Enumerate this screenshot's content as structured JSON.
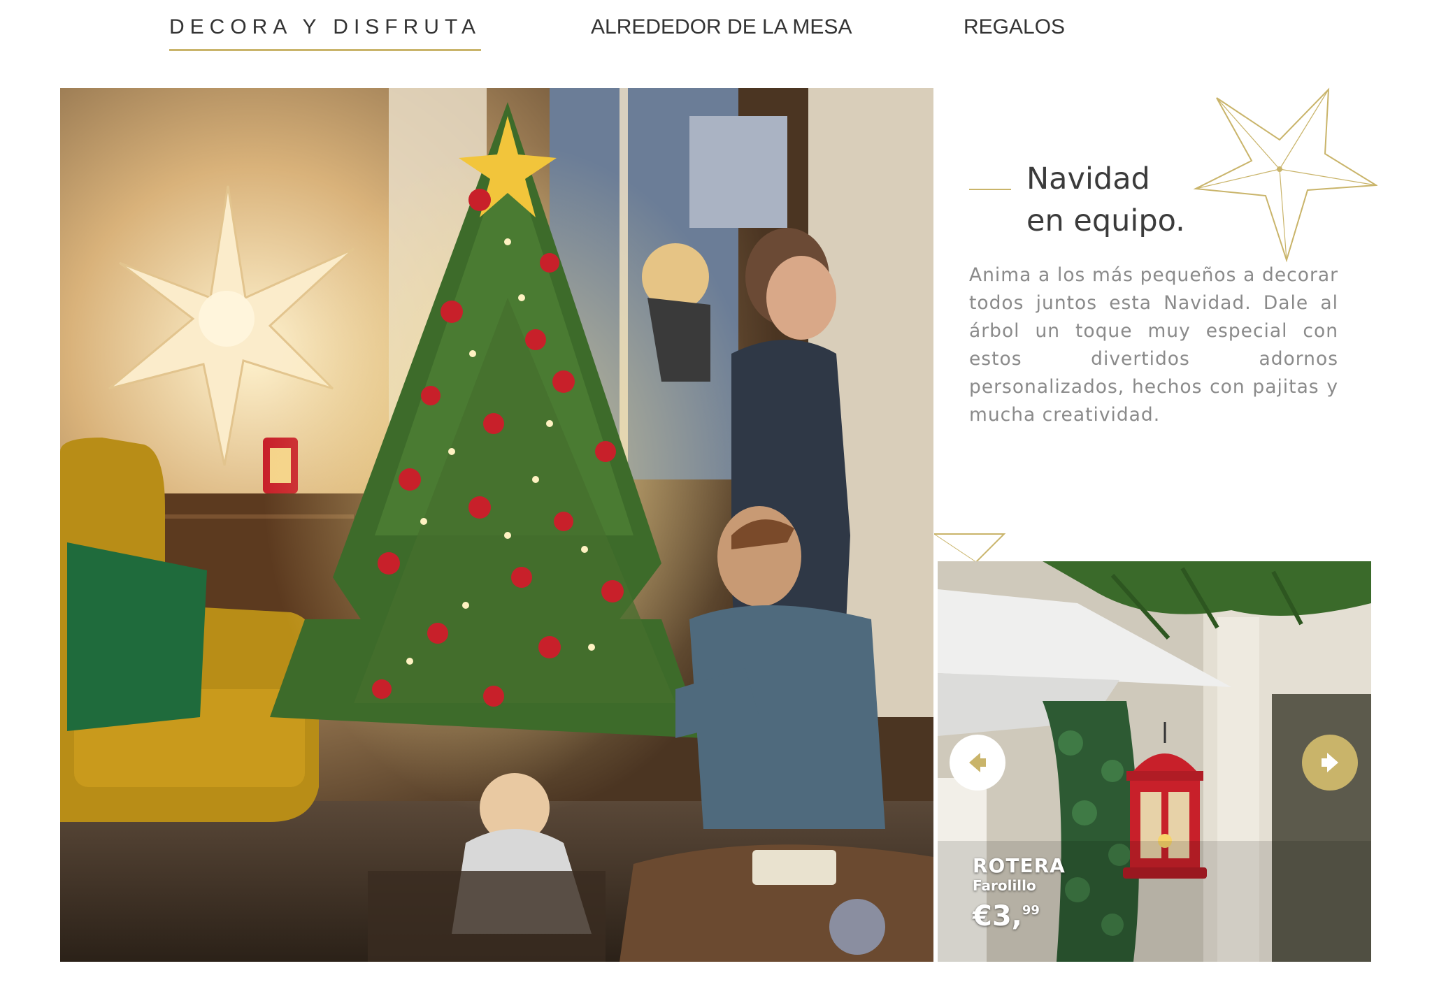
{
  "nav": {
    "tabs": [
      {
        "label": "DECORA Y DISFRUTA",
        "active": true
      },
      {
        "label": "ALREDEDOR DE LA MESA",
        "active": false
      },
      {
        "label": "REGALOS",
        "active": false
      }
    ]
  },
  "article": {
    "title_line1": "Navidad",
    "title_line2": "en equipo.",
    "body": "Anima a los más pequeños a decorar todos juntos esta Navidad. Dale al árbol un toque muy especial con estos divertidos adornos personalizados, hechos con pajitas y mucha creatividad."
  },
  "product": {
    "name": "ROTERA",
    "type": "Farolillo",
    "price_main": "€3,",
    "price_cents": "99"
  },
  "colors": {
    "accent_gold": "#c9b46a",
    "text_dark": "#3b3b3b",
    "text_muted": "#8a8a8a",
    "lantern_red": "#c8202a"
  },
  "icons": {
    "prev": "arrow-left-icon",
    "next": "arrow-right-icon",
    "star_decoration": "star-outline-icon"
  }
}
